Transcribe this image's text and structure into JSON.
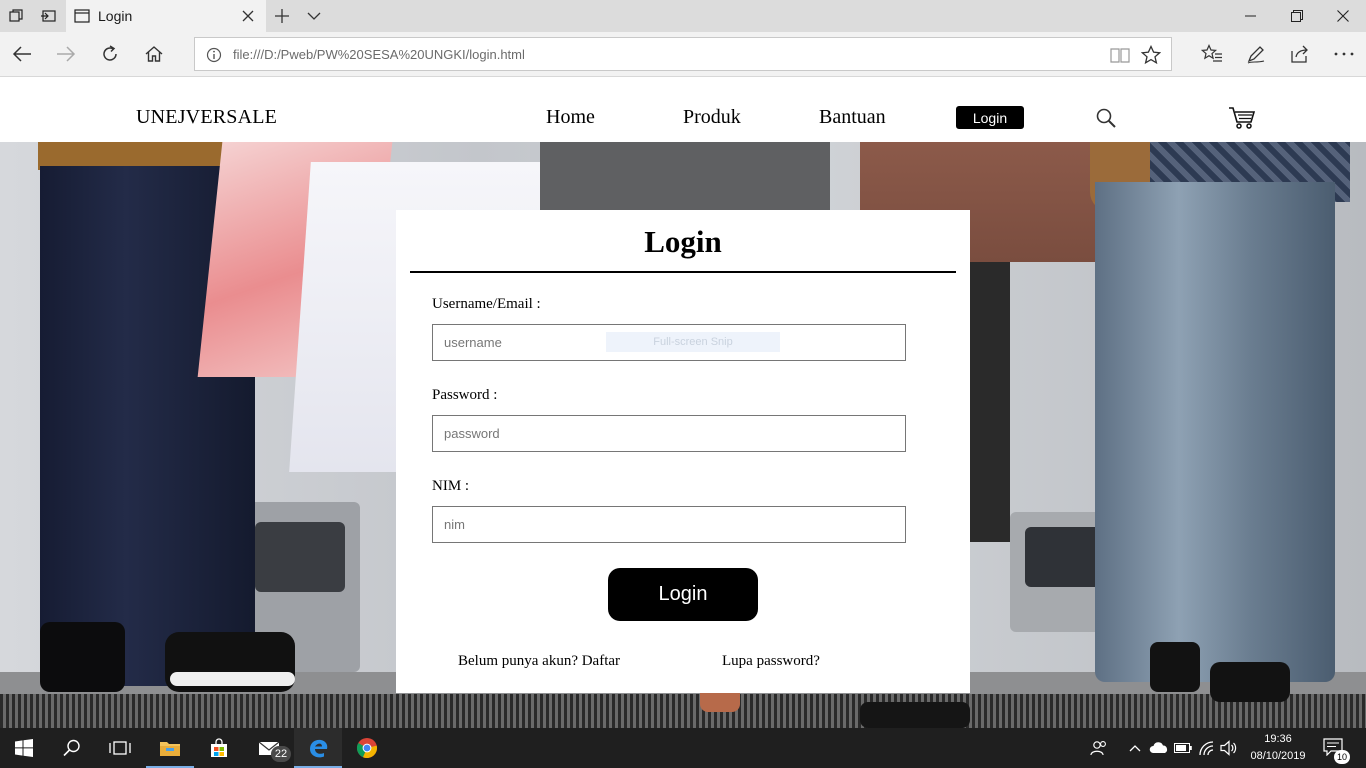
{
  "browser": {
    "tab_title": "Login",
    "url": "file:///D:/Pweb/PW%20SESA%20UNGKI/login.html"
  },
  "site": {
    "brand": "UNEJVERSALE",
    "nav": [
      {
        "label": "Home"
      },
      {
        "label": "Produk"
      },
      {
        "label": "Bantuan"
      }
    ],
    "login_button": "Login"
  },
  "login_card": {
    "title": "Login",
    "username": {
      "label": "Username/Email :",
      "placeholder": "username",
      "value": ""
    },
    "password": {
      "label": "Password :",
      "placeholder": "password",
      "value": ""
    },
    "nim": {
      "label": "NIM :",
      "placeholder": "nim",
      "value": ""
    },
    "snip_overlay": "Full-screen Snip",
    "submit_label": "Login",
    "register_link": "Belum punya akun? Daftar",
    "forgot_link": "Lupa password?"
  },
  "taskbar": {
    "mail_badge": "22",
    "time": "19:36",
    "date": "08/10/2019",
    "notifications": "10"
  },
  "colors": {
    "accent": "#000000",
    "taskbar": "#1f1f1f",
    "tab_strip": "#dcdcdc",
    "address_bar": "#f2f2f2"
  }
}
